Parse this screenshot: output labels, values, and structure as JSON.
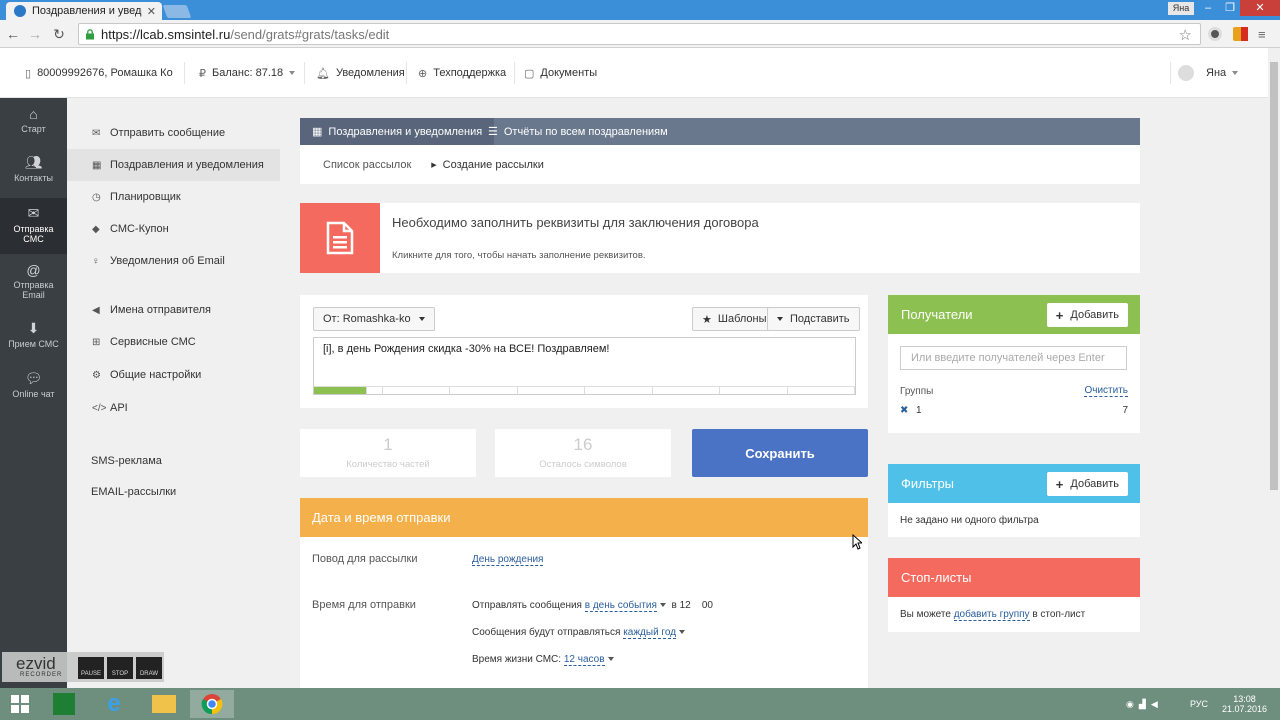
{
  "browser": {
    "tab_title": "Поздравления и уведомл",
    "url_main": "https://lcab.smsintel.ru",
    "url_rest": "/send/grats#grats/tasks/edit",
    "user_badge": "Яна"
  },
  "header": {
    "account": "80009992676, Ромашка Ко",
    "balance_label": "Баланс:",
    "balance_value": "87.18",
    "notifications": "Уведомления",
    "support": "Техподдержка",
    "documents": "Документы",
    "user": "Яна"
  },
  "leftnav": [
    {
      "label": "Старт",
      "icon": "home-icon"
    },
    {
      "label": "Контакты",
      "icon": "contacts-icon"
    },
    {
      "label": "Отправка СМС",
      "icon": "envelope-icon"
    },
    {
      "label": "Отправка Email",
      "icon": "at-icon"
    },
    {
      "label": "Прием СМС",
      "icon": "download-icon"
    },
    {
      "label": "Online чат",
      "icon": "chat-icon"
    }
  ],
  "submenu": {
    "items": [
      {
        "label": "Отправить сообщение"
      },
      {
        "label": "Поздравления и уведомления"
      },
      {
        "label": "Планировщик"
      },
      {
        "label": "СМС-Купон"
      },
      {
        "label": "Уведомления об Email"
      },
      {
        "label": "Имена отправителя"
      },
      {
        "label": "Сервисные СМС"
      },
      {
        "label": "Общие настройки"
      },
      {
        "label": "API"
      }
    ],
    "sms_ads": "SMS-реклама",
    "email_ads": "EMAIL-рассылки"
  },
  "tabs": {
    "tab1": "Поздравления и уведомления",
    "tab2": "Отчёты по всем поздравлениям"
  },
  "breadcrumb": {
    "list": "Список рассылок",
    "current": "Создание рассылки"
  },
  "notice": {
    "title": "Необходимо заполнить реквизиты для заключения договора",
    "subtitle": "Кликните для того, чтобы начать заполнение реквизитов."
  },
  "message": {
    "from": "От: Romashka-ko",
    "templates": "Шаблоны",
    "insert": "Подставить",
    "text": "[i], в день Рождения скидка -30% на ВСЕ! Поздравляем!"
  },
  "stats": {
    "parts_value": "1",
    "parts_label": "Количество частей",
    "remaining_value": "16",
    "remaining_label": "Осталось символов"
  },
  "save_label": "Сохранить",
  "datetime": {
    "title": "Дата и время отправки",
    "reason_label": "Повод для рассылки",
    "reason_value": "День рождения",
    "time_label": "Время для отправки",
    "send_prefix": "Отправлять сообщения",
    "send_when": "в день события",
    "send_at": "в",
    "hour": "12",
    "minute": "00",
    "repeat_prefix": "Сообщения будут отправляться",
    "repeat_value": "каждый год",
    "ttl_prefix": "Время жизни СМС:",
    "ttl_value": "12 часов"
  },
  "recipients": {
    "title": "Получатели",
    "add": "Добавить",
    "placeholder": "Или введите получателей через Enter",
    "groups": "Группы",
    "clear": "Очистить",
    "group_name": "1",
    "group_count": "7"
  },
  "filters": {
    "title": "Фильтры",
    "add": "Добавить",
    "empty": "Не задано ни одного фильтра"
  },
  "stoplists": {
    "title": "Стоп-листы",
    "text_before": "Вы можете",
    "link": "добавить группу",
    "text_after": "в стоп-лист"
  },
  "taskbar": {
    "lang": "РУС",
    "time": "13:08",
    "date": "21.07.2016"
  },
  "ezvid": {
    "logo": "ezvid",
    "sub": "RECORDER",
    "pause": "PAUSE",
    "stop": "STOP",
    "draw": "DRAW"
  },
  "colors": {
    "tab_bar": "#6a788d",
    "notice_red": "#f46a5e",
    "save_blue": "#4a72c5",
    "date_orange": "#f4b04a",
    "recipients_green": "#8cc152",
    "filters_cyan": "#4fc1e9",
    "stoplist_red": "#f46a5e"
  }
}
